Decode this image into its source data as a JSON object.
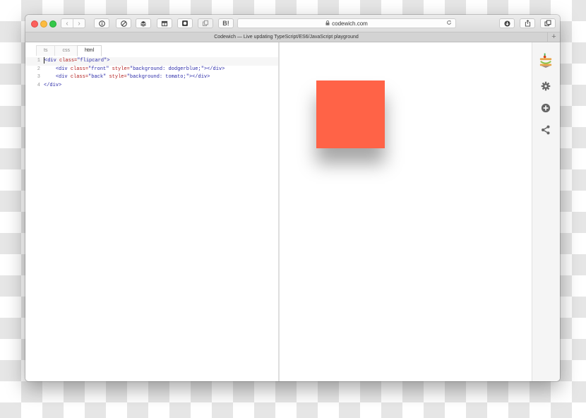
{
  "browser": {
    "url": "codewich.com",
    "tab_title": "Codewich — Live updating TypeScript/ES6/JavaScript playground",
    "new_tab_label": "+",
    "bookmarklet_label": "B!",
    "nav_back": "‹",
    "nav_forward": "›"
  },
  "editor": {
    "tabs": [
      {
        "label": "ts",
        "active": false
      },
      {
        "label": "css",
        "active": false
      },
      {
        "label": "html",
        "active": true
      }
    ],
    "lines": [
      {
        "number": "1",
        "indent": "",
        "tag_open": "<div",
        "attr1": "class=",
        "val1": "\"flipcard\"",
        "attr2": "",
        "val2": "",
        "tag_close": ">"
      },
      {
        "number": "2",
        "indent": "    ",
        "tag_open": "<div",
        "attr1": "class=",
        "val1": "\"front\"",
        "attr2": "style=",
        "val2": "\"background: dodgerblue;\"",
        "tag_close": "></div>"
      },
      {
        "number": "3",
        "indent": "    ",
        "tag_open": "<div",
        "attr1": "class=",
        "val1": "\"back\"",
        "attr2": "style=",
        "val2": "\"background: tomato;\"",
        "tag_close": "></div>"
      },
      {
        "number": "4",
        "indent": "",
        "tag_open": "</div>",
        "attr1": "",
        "val1": "",
        "attr2": "",
        "val2": "",
        "tag_close": ""
      }
    ]
  },
  "preview": {
    "card_color": "#ff6347"
  },
  "sidebar": {
    "icons": [
      "codewich-logo-icon",
      "gear-icon",
      "plus-circle-icon",
      "share-icon"
    ]
  },
  "colors": {
    "traffic_red": "#fc605c",
    "traffic_yellow": "#fdbc40",
    "traffic_green": "#34c84a",
    "tag": "#2a2aa8",
    "attribute": "#b32020"
  }
}
